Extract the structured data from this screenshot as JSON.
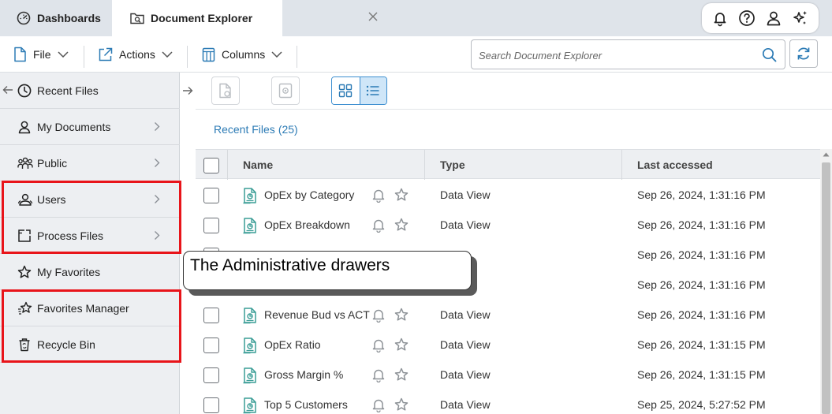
{
  "tabs": [
    {
      "label": "Dashboards",
      "icon": "gauge-icon"
    },
    {
      "label": "Document Explorer",
      "icon": "folder-search-icon",
      "closable": true
    }
  ],
  "user_tools": [
    "bell-icon",
    "help-icon",
    "user-icon",
    "ai-sparkle-icon"
  ],
  "toolbar": {
    "file_label": "File",
    "actions_label": "Actions",
    "columns_label": "Columns"
  },
  "search": {
    "placeholder": "Search Document Explorer"
  },
  "sidebar": {
    "items": [
      {
        "label": "Recent Files",
        "icon": "clock-icon",
        "chevron": false
      },
      {
        "label": "My Documents",
        "icon": "person-icon",
        "chevron": true
      },
      {
        "label": "Public",
        "icon": "group-icon",
        "chevron": true
      },
      {
        "label": "Users",
        "icon": "users-icon",
        "chevron": true
      },
      {
        "label": "Process Files",
        "icon": "process-folder-icon",
        "chevron": true
      },
      {
        "label": "My Favorites",
        "icon": "star-icon",
        "chevron": false
      },
      {
        "label": "Favorites Manager",
        "icon": "star-manager-icon",
        "chevron": false
      },
      {
        "label": "Recycle Bin",
        "icon": "recycle-bin-icon",
        "chevron": false
      }
    ]
  },
  "main": {
    "breadcrumb_label": "Recent Files",
    "breadcrumb_count": "(25)",
    "columns": {
      "name": "Name",
      "type": "Type",
      "last_accessed": "Last accessed"
    },
    "rows": [
      {
        "name": "OpEx by Category",
        "type": "Data View",
        "accessed": "Sep 26, 2024, 1:31:16 PM"
      },
      {
        "name": "OpEx Breakdown",
        "type": "Data View",
        "accessed": "Sep 26, 2024, 1:31:16 PM"
      },
      {
        "name": "",
        "type": "",
        "accessed": "Sep 26, 2024, 1:31:16 PM"
      },
      {
        "name": "",
        "type": "",
        "accessed": "Sep 26, 2024, 1:31:16 PM"
      },
      {
        "name": "Revenue Bud vs ACT",
        "type": "Data View",
        "accessed": "Sep 26, 2024, 1:31:16 PM"
      },
      {
        "name": "OpEx Ratio",
        "type": "Data View",
        "accessed": "Sep 26, 2024, 1:31:15 PM"
      },
      {
        "name": "Gross Margin %",
        "type": "Data View",
        "accessed": "Sep 26, 2024, 1:31:15 PM"
      },
      {
        "name": "Top 5 Customers",
        "type": "Data View",
        "accessed": "Sep 25, 2024, 5:27:52 PM"
      }
    ]
  },
  "callout": {
    "text": "The Administrative drawers"
  },
  "colors": {
    "accent": "#2c7bb5",
    "highlight": "#e8141a",
    "sidebar_bg": "#edeff2",
    "teal_icon": "#3a9d96"
  }
}
